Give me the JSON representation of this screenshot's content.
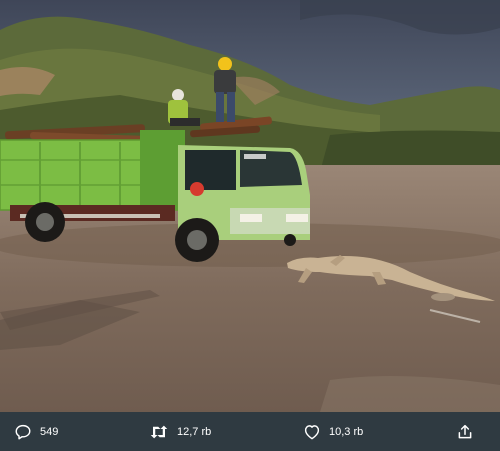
{
  "post": {
    "photo_icon": "photo-icon",
    "actions": {
      "reply": {
        "icon": "reply-icon",
        "count": "549"
      },
      "retweet": {
        "icon": "retweet-icon",
        "count": "12,7 rb"
      },
      "like": {
        "icon": "heart-icon",
        "count": "10,3 rb"
      },
      "share": {
        "icon": "share-icon"
      }
    }
  },
  "colors": {
    "action_bar": "#2f3a41",
    "truck_body": "#7cbd44",
    "truck_cab": "#a9cf7c",
    "ground": "#837060",
    "sky": "#4c5668"
  }
}
